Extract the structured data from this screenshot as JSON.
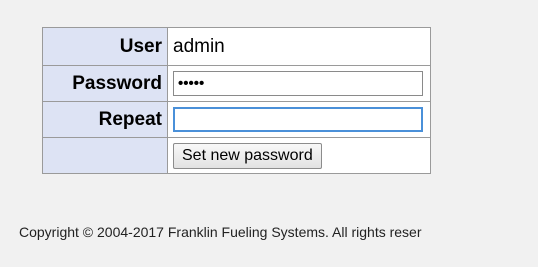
{
  "form": {
    "user_label": "User",
    "user_value": "admin",
    "password_label": "Password",
    "password_value": "•••••",
    "repeat_label": "Repeat",
    "repeat_value": "",
    "submit_label": "Set new password"
  },
  "footer": {
    "copyright": "Copyright © 2004-2017 Franklin Fueling Systems. All rights reser"
  }
}
